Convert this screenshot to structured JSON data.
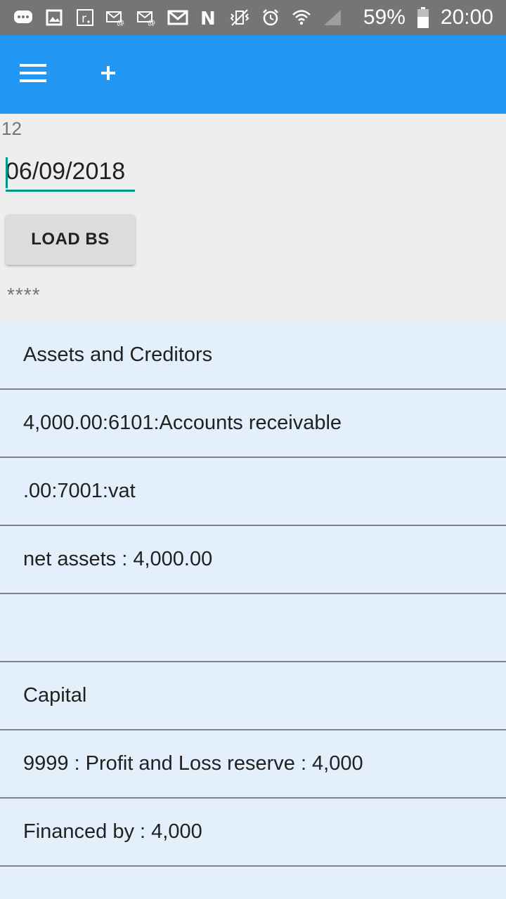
{
  "status_bar": {
    "battery_percent": "59%",
    "time": "20:00",
    "icons": [
      "chat-icon",
      "image-icon",
      "r-icon",
      "email-icon",
      "email-icon",
      "gmail-icon",
      "n-icon",
      "vibrate-icon",
      "alarm-icon",
      "wifi-icon",
      "signal-icon",
      "battery-icon"
    ]
  },
  "app_bar": {
    "menu_icon": "hamburger-menu-icon",
    "add_icon": "plus-icon",
    "color": "#2196f3"
  },
  "form": {
    "counter": "12",
    "date_value": "06/09/2018",
    "load_button": "LOAD BS",
    "status_text": "****"
  },
  "list": {
    "items": [
      "Assets and Creditors",
      "4,000.00:6101:Accounts receivable",
      ".00:7001:vat",
      "net assets : 4,000.00",
      "",
      "Capital",
      "9999 : Profit and Loss reserve : 4,000",
      "Financed by : 4,000"
    ]
  }
}
